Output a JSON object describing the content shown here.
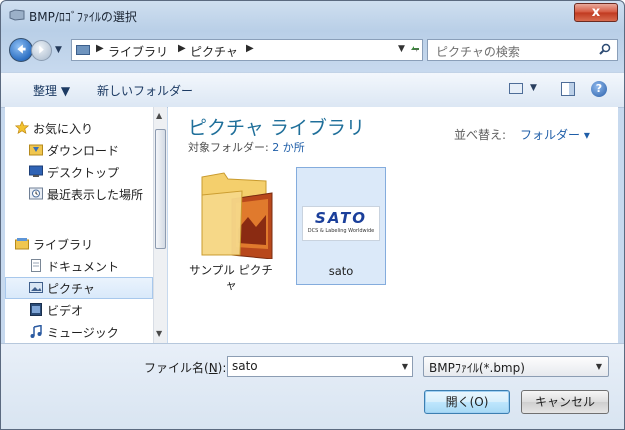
{
  "window": {
    "title": "BMP/ﾛｺﾞﾌｧｲﾙの選択",
    "close_label": "x"
  },
  "address": {
    "crumbs": [
      "ライブラリ",
      "ピクチャ"
    ],
    "search_placeholder": "ピクチャの検索"
  },
  "toolbar": {
    "organize_label": "整理 ▼",
    "new_folder_label": "新しいフォルダー",
    "help_label": "?"
  },
  "nav_pane": {
    "items": [
      {
        "label": "お気に入り",
        "icon": "star-icon"
      },
      {
        "label": "ダウンロード",
        "icon": "download-folder-icon"
      },
      {
        "label": "デスクトップ",
        "icon": "desktop-icon"
      },
      {
        "label": "最近表示した場所",
        "icon": "recent-places-icon"
      },
      {
        "label": "ライブラリ",
        "icon": "library-icon"
      },
      {
        "label": "ドキュメント",
        "icon": "document-icon"
      },
      {
        "label": "ピクチャ",
        "icon": "pictures-icon",
        "selected": true
      },
      {
        "label": "ビデオ",
        "icon": "video-icon"
      },
      {
        "label": "ミュージック",
        "icon": "music-icon"
      }
    ]
  },
  "content": {
    "library_title": "ピクチャ ライブラリ",
    "subtitle_prefix": "対象フォルダー: ",
    "subtitle_link": "2 か所",
    "sort_label": "並べ替え:",
    "sort_value": "フォルダー ▾",
    "items": [
      {
        "caption_line1": "サンプル ピクチ",
        "caption_line2": "ャ",
        "icon": "folder-icon"
      },
      {
        "caption_line1": "sato",
        "caption_line2": "",
        "icon": "image-thumbnail-icon",
        "selected": true,
        "logo_text": "SATO",
        "logo_tagline": "DCS & Labeling Worldwide"
      }
    ]
  },
  "footer": {
    "filename_label": "ファイル名(",
    "filename_mnemonic": "N",
    "filename_label_end": "):",
    "filename_value": "sato",
    "filter_value": "BMPﾌｧｲﾙ(*.bmp)",
    "open_label": "開く(O)",
    "cancel_label": "キャンセル"
  },
  "colors": {
    "accent": "#1f6f9a",
    "link": "#1f5ea8",
    "selection": "#dbe9f9"
  }
}
